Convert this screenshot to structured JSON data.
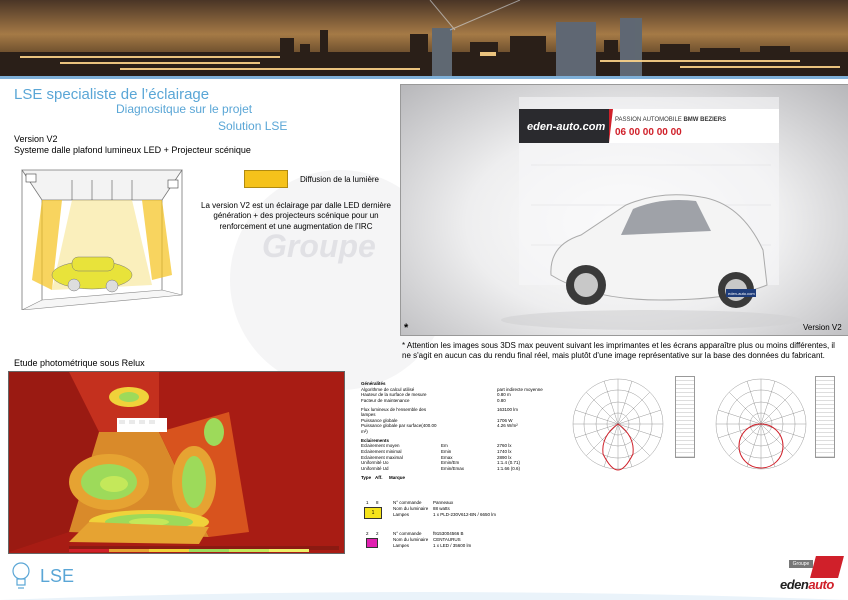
{
  "titles": {
    "main": "LSE specialiste de l’éclairage",
    "sub1": "Diagnositque sur le projet",
    "sub2": "Solution LSE"
  },
  "version": {
    "label": "Version V2",
    "subtitle": "Systeme dalle plafond lumineux LED + Projecteur scénique"
  },
  "legend": {
    "label": "Diffusion de la lumière",
    "color": "#f5c21b"
  },
  "description": "La version V2 est un éclairage par dalle LED dernière génération + des projecteurs scénique pour un renforcement  et une augmentation de l’IRC",
  "watermark": "Groupe",
  "photo": {
    "brand_sign": "eden-auto.com",
    "dealer_line": "PASSION AUTOMOBILE",
    "dealer_name": "BMW BEZIERS",
    "phone": "06 00 00 00 00",
    "plate": "eden-auto.com",
    "star": "*",
    "version": "Version V2"
  },
  "notice": "* Attention les images sous 3DS max peuvent suivant les imprimantes et les écrans apparaître plus ou moins différentes, il ne s'agit en aucun cas du rendu final réel, mais plutôt d'une image représentative sur la base des données du fabricant.",
  "relux": {
    "title": "Etude photométrique sous Relux"
  },
  "sheet": {
    "general_title": "Généralités",
    "general": [
      [
        "Algorithme de calcul utilisé",
        "part indirecte moyenne"
      ],
      [
        "Hauteur de la surface de mesure",
        "0.80 m"
      ],
      [
        "Facteur de maintenance",
        "0.80"
      ]
    ],
    "flux": [
      [
        "Flux lumineux de l'ensemble des lampes",
        "163100 lm"
      ],
      [
        "Puissance globale",
        "1706 W"
      ],
      [
        "Puissance globale par surface(400.00 m²)",
        "4.26 W/m²"
      ]
    ],
    "eclair_title": "Eclairements",
    "eclair": [
      [
        "Eclairement moyen",
        "Em",
        "2760 lx"
      ],
      [
        "Eclairement minimal",
        "Emin",
        "1740 lx"
      ],
      [
        "Eclairement maximal",
        "Emax",
        "2890 lx"
      ],
      [
        "Uniformité Uo",
        "Emin/Em",
        "1:1.4 (0.71)"
      ],
      [
        "Uniformité Ud",
        "Emin/Emax",
        "1:1.66 (0.6)"
      ]
    ],
    "type_header": [
      "Type",
      "Aff.",
      "Marque"
    ],
    "luminaires": [
      {
        "type": "1",
        "count": "8",
        "badge": "1",
        "color": "#f5e31a",
        "lines": [
          [
            "N° commande",
            "Panneaux"
          ],
          [
            "Nom du luminaire",
            "88 watts"
          ],
          [
            "Lampes",
            "1 x PLD-230V612-BN  / 6650 lm"
          ]
        ]
      },
      {
        "type": "2",
        "count": "2",
        "badge": "",
        "color": "#e020b0",
        "lines": [
          [
            "N° commande",
            "f9153004566 B"
          ],
          [
            "Nom du luminaire",
            "CENTAURUS"
          ],
          [
            "Lampes",
            "1 x LED  / 35600 lm"
          ]
        ]
      }
    ]
  },
  "logo": {
    "lse": "LSE",
    "groupe": "Groupe",
    "eden_main": "eden",
    "eden_accent": "auto"
  }
}
